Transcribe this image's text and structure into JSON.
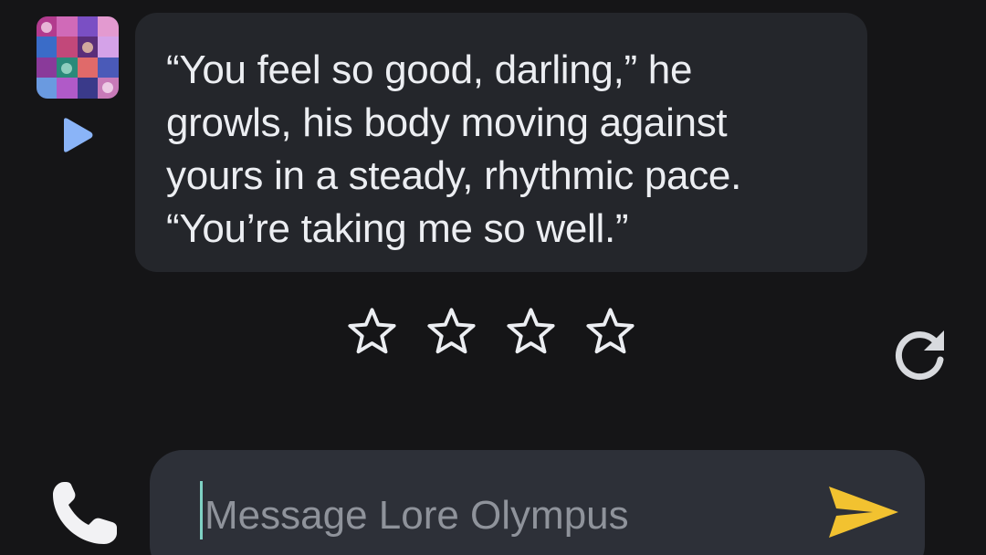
{
  "message": {
    "text": "“You feel so good, darling,” he\ngrowls, his body moving against\nyours in a steady, rhythmic pace.\n“You’re taking me so well.”"
  },
  "rating": {
    "stars_total": 4,
    "stars_selected": 0
  },
  "composer": {
    "placeholder": "Message Lore Olympus",
    "value": ""
  },
  "icons": {
    "avatar": "character-avatar",
    "play": "play-icon",
    "star": "star-outline-icon",
    "regenerate": "refresh-icon",
    "call": "phone-icon",
    "send": "send-icon"
  },
  "colors": {
    "background": "#151517",
    "bubble": "#24262b",
    "composer": "#2d3038",
    "play_accent": "#8ab4f8",
    "send_accent": "#f2c230",
    "text": "#eceef2",
    "placeholder": "#8f939b",
    "cursor": "#7fd1c4"
  }
}
